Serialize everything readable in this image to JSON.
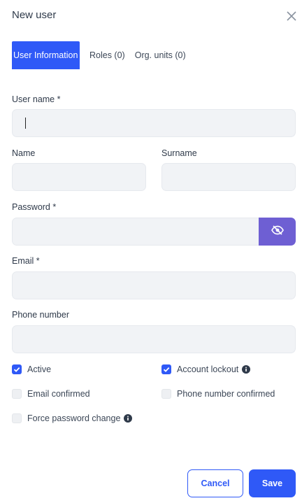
{
  "dialog": {
    "title": "New user",
    "close_icon": "close-icon"
  },
  "tabs": [
    {
      "label": "User Information",
      "active": true
    },
    {
      "label": "Roles (0)",
      "active": false
    },
    {
      "label": "Org. units (0)",
      "active": false
    }
  ],
  "form": {
    "username": {
      "label": "User name *",
      "value": ""
    },
    "name": {
      "label": "Name",
      "value": ""
    },
    "surname": {
      "label": "Surname",
      "value": ""
    },
    "password": {
      "label": "Password *",
      "value": "",
      "toggle_icon": "eye-slash-icon"
    },
    "email": {
      "label": "Email *",
      "value": ""
    },
    "phone": {
      "label": "Phone number",
      "value": ""
    }
  },
  "checkboxes": {
    "active": {
      "label": "Active",
      "checked": true
    },
    "lockout": {
      "label": "Account lockout",
      "checked": true,
      "info_icon": "info-icon"
    },
    "email_confirmed": {
      "label": "Email confirmed",
      "checked": false
    },
    "phone_confirmed": {
      "label": "Phone number confirmed",
      "checked": false
    },
    "force_password_change": {
      "label": "Force password change",
      "checked": false,
      "info_icon": "info-icon"
    }
  },
  "footer": {
    "cancel_label": "Cancel",
    "save_label": "Save"
  },
  "colors": {
    "primary": "#2f59f7",
    "eye_button": "#6e5fd3",
    "field_bg": "#f1f3f6"
  }
}
